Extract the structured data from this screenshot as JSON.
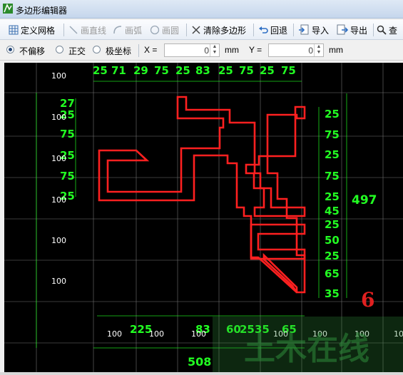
{
  "window": {
    "title": "多边形编辑器"
  },
  "toolbar": {
    "define_grid": "定义网格",
    "draw_line": "画直线",
    "draw_arc": "画弧",
    "draw_circle": "画圆",
    "clear_polygon": "清除多边形",
    "undo": "回退",
    "import": "导入",
    "export": "导出",
    "search": "查"
  },
  "options": {
    "mode_no_offset": "不偏移",
    "mode_orthogonal": "正交",
    "mode_polar": "极坐标",
    "x_label": "X =",
    "x_value": "0",
    "x_unit": "mm",
    "y_label": "Y =",
    "y_value": "0",
    "y_unit": "mm"
  },
  "colors": {
    "canvas_bg": "#000000",
    "grid_line": "#ffffff",
    "dimension_text": "#22ff22",
    "polygon": "#ff2020",
    "grid_label": "#ffffff",
    "watermark": "#2e8b3a",
    "marker": "#e02020"
  },
  "canvas": {
    "top_dimensions": [
      "25",
      "71",
      "29",
      "75",
      "25",
      "83",
      "25",
      "75",
      "25",
      "75"
    ],
    "left_dimensions": [
      "27",
      "25",
      "75",
      "25",
      "75",
      "25"
    ],
    "right_dimensions": [
      "25",
      "75",
      "25",
      "75",
      "25",
      "45",
      "25",
      "50",
      "25",
      "65",
      "35"
    ],
    "right_total": "497",
    "bottom_dimensions": [
      "225",
      "83",
      "60",
      "25",
      "35",
      "65"
    ],
    "bottom_total": "508",
    "row_grid_labels": [
      "100",
      "100",
      "100",
      "100",
      "100",
      "100"
    ],
    "col_grid_labels": [
      "100",
      "100",
      "100",
      "100",
      "100",
      "100",
      "100"
    ],
    "marker_number": "6",
    "watermark_text": "土木在线"
  }
}
